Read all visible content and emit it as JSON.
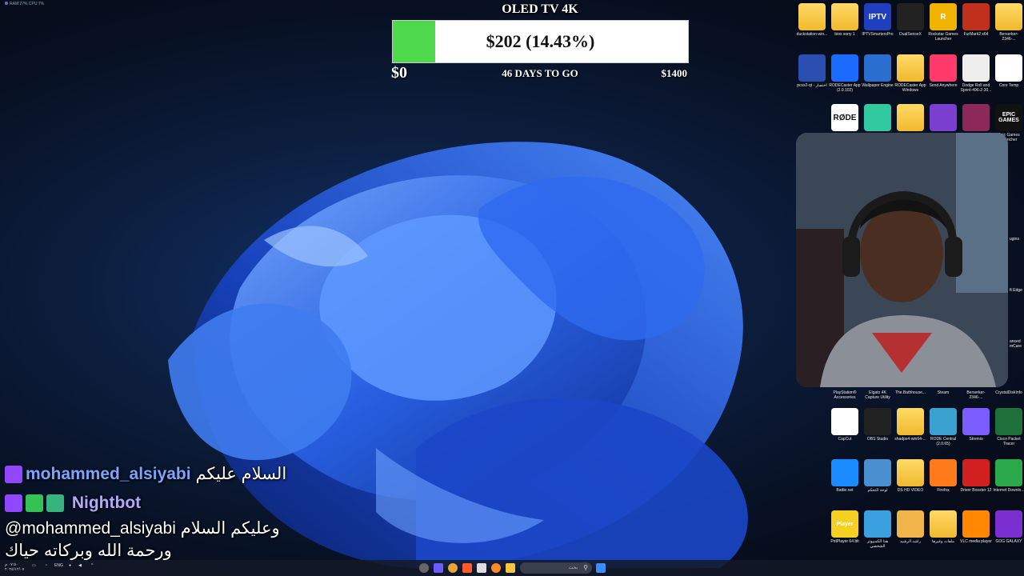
{
  "system_stats": "RAM:27%  CPU:7%",
  "goal": {
    "title": "OLED TV 4K",
    "amount_text": "$202 (14.43%)",
    "progress": 0.1443,
    "min_label": "$0",
    "days_label": "46 DAYS TO GO",
    "max_label": "$1400",
    "fill_color": "#4ed84c"
  },
  "desktop_icons": [
    {
      "label": "duckstation-win...",
      "icon": "folder-icon"
    },
    {
      "label": "bios sony 1",
      "icon": "folder-icon"
    },
    {
      "label": "IPTVSmartersPro",
      "icon": "iptv-icon",
      "text": "IPTV"
    },
    {
      "label": "DualSenseX",
      "icon": "controller-icon"
    },
    {
      "label": "Rockstar Games Launcher",
      "icon": "rockstar-icon",
      "text": "R"
    },
    {
      "label": "FurMark2 x64",
      "icon": "flame-icon"
    },
    {
      "label": "Berserker-2346-...",
      "icon": "folder-icon"
    },
    {
      "label": "pcsx2-qt - اختصار",
      "icon": "pcsx2-icon"
    },
    {
      "label": "RODECaster App (2.0.102)",
      "icon": "rodecaster-icon"
    },
    {
      "label": "Wallpaper Engine",
      "icon": "wallpaper-engine-icon"
    },
    {
      "label": "RODECaster App Windows v2.0.105",
      "icon": "folder-icon"
    },
    {
      "label": "Send Anywhere",
      "icon": "send-anywhere-icon"
    },
    {
      "label": "Dodge Roll and Sprint-496-2-30...",
      "icon": "file-icon"
    },
    {
      "label": "Core Temp",
      "icon": "core-temp-icon"
    },
    {
      "label": "",
      "icon": "rode-icon",
      "text": "RØDE"
    },
    {
      "label": "",
      "icon": "streamlabs-icon"
    },
    {
      "label": "",
      "icon": "folder-icon"
    },
    {
      "label": "",
      "icon": "chip-icon"
    },
    {
      "label": "",
      "icon": "winrar-icon"
    },
    {
      "label": "Epic Games Launcher",
      "icon": "epic-games-icon",
      "text": "EPIC GAMES"
    },
    {
      "label": "PlayStation® Accessories",
      "icon": "playstation-icon"
    },
    {
      "label": "Elgato 4K Capture Utility",
      "icon": "elgato-icon"
    },
    {
      "label": "The.Bathhouse...",
      "icon": "file-icon"
    },
    {
      "label": "Steam",
      "icon": "steam-icon"
    },
    {
      "label": "Berserker-2346-...",
      "icon": "folder-icon"
    },
    {
      "label": "CrystalDiskInfo",
      "icon": "crystaldisk-icon"
    },
    {
      "label": "CapCut",
      "icon": "capcut-icon"
    },
    {
      "label": "OBS Studio",
      "icon": "obs-icon"
    },
    {
      "label": "shadps4-win64-...",
      "icon": "folder-icon"
    },
    {
      "label": "RODE Central (2.0.65)",
      "icon": "rode-central-icon"
    },
    {
      "label": "Stremio",
      "icon": "stremio-icon"
    },
    {
      "label": "Cisco Packet Tracer",
      "icon": "cisco-icon"
    },
    {
      "label": "Battle.net",
      "icon": "battlenet-icon"
    },
    {
      "label": "لوحة التحكم",
      "icon": "control-panel-icon"
    },
    {
      "label": "DS HD VIDEO",
      "icon": "folder-icon"
    },
    {
      "label": "Firefox",
      "icon": "firefox-icon"
    },
    {
      "label": "Driver Booster 12",
      "icon": "driver-booster-icon"
    },
    {
      "label": "Internet Downlo...",
      "icon": "idm-icon"
    },
    {
      "label": "PotPlayer 64 bit",
      "icon": "potplayer-icon",
      "text": "Player"
    },
    {
      "label": "هذا الكمبيوتر الشخصي",
      "icon": "this-pc-icon"
    },
    {
      "label": "راشد الرشيد",
      "icon": "user-folder-icon"
    },
    {
      "label": "ملفات وغيرها",
      "icon": "folder-icon"
    },
    {
      "label": "VLC media player",
      "icon": "vlc-icon"
    },
    {
      "label": "GOG GALAXY",
      "icon": "gog-icon"
    }
  ],
  "side_labels": [
    "ugins",
    "ft Edge",
    "anced mCare"
  ],
  "chat": [
    {
      "username": "mohammed_alsiyabi",
      "message": "السلام عليكم"
    },
    {
      "username": "Nightbot",
      "message": ""
    },
    {
      "username": "",
      "message": "@mohammed_alsiyabi وعليكم السلام"
    },
    {
      "username": "",
      "message": "ورحمة الله وبركاته حياك"
    }
  ],
  "taskbar": {
    "search_placeholder": "بحث",
    "language": "ENG",
    "time": "٠٧:٥٠ م",
    "date": "٢٠٢٤/١٢/٠٧"
  }
}
